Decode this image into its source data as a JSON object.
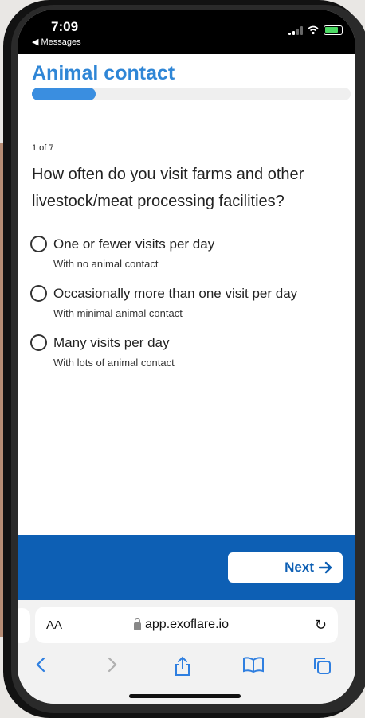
{
  "status_bar": {
    "time": "7:09",
    "back_app": "◀ Messages"
  },
  "page": {
    "title": "Animal contact",
    "progress": 0.2,
    "step": "1 of 7"
  },
  "question": "How often do you visit farms and other livestock/meat processing facilities?",
  "options": [
    {
      "label": "One or fewer visits per day",
      "sub": "With no animal contact"
    },
    {
      "label": "Occasionally more than one visit per day",
      "sub": "With minimal animal contact"
    },
    {
      "label": "Many visits per day",
      "sub": "With lots of animal contact"
    }
  ],
  "footer": {
    "next_label": "Next",
    "next_icon": "arrow-right-icon"
  },
  "browser": {
    "aa_label": "AA",
    "url": "app.exoflare.io",
    "icons": [
      "back-icon",
      "forward-icon",
      "share-icon",
      "bookmarks-icon",
      "tabs-icon"
    ]
  },
  "colors": {
    "accent": "#2f86d6",
    "footer": "#0d5fb4",
    "progress": "#3a8ee0"
  }
}
